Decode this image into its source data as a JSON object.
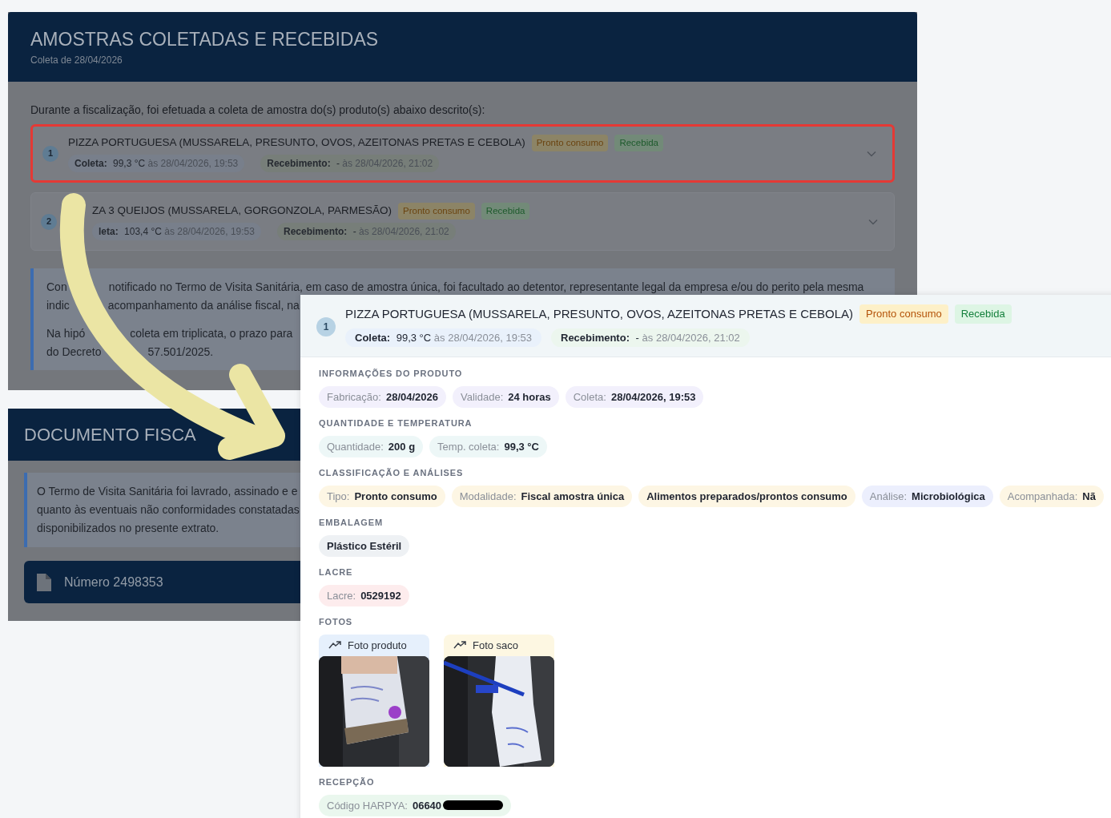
{
  "background_page": {
    "samples_section": {
      "title": "AMOSTRAS COLETADAS E RECEBIDAS",
      "subtitle": "Coleta de 28/04/2026",
      "intro": "Durante a fiscalização, foi efetuada a coleta de amostra do(s) produto(s) abaixo descrito(s):",
      "samples": [
        {
          "number": "1",
          "name": "PIZZA PORTUGUESA (MUSSARELA, PRESUNTO, OVOS, AZEITONAS PRETAS E CEBOLA)",
          "tags": [
            {
              "label": "Pronto consumo",
              "kind": "category"
            },
            {
              "label": "Recebida",
              "kind": "status"
            }
          ],
          "coleta_label": "Coleta:",
          "coleta_value": "99,3 °C",
          "coleta_time": "às 28/04/2026, 19:53",
          "recebimento_label": "Recebimento:",
          "recebimento_value": "-",
          "recebimento_time": "às 28/04/2026, 21:02",
          "highlighted": true
        },
        {
          "number": "2",
          "name": "ZA 3 QUEIJOS (MUSSARELA, GORGONZOLA, PARMESÃO)",
          "tags": [
            {
              "label": "Pronto consumo",
              "kind": "category"
            },
            {
              "label": "Recebida",
              "kind": "status"
            }
          ],
          "coleta_label": "leta:",
          "coleta_value": "103,4 °C",
          "coleta_time": "às 28/04/2026, 19:53",
          "recebimento_label": "Recebimento:",
          "recebimento_value": "-",
          "recebimento_time": "às 28/04/2026, 21:02",
          "highlighted": false
        }
      ],
      "note_lines": [
        {
          "left": "Con",
          "right": "notificado no Termo de Visita Sanitária, em caso de amostra única, foi facultado ao detentor, representante legal da empresa e/ou do perito pela mesma"
        },
        {
          "left": "indic",
          "right": "acompanhamento da análise fiscal, na"
        },
        {
          "left": "Na hipó",
          "right": "coleta em triplicata, o prazo para"
        },
        {
          "left": "do Decreto",
          "right": "57.501/2025."
        }
      ]
    },
    "document_section": {
      "title": "DOCUMENTO FISCA",
      "note_lines": [
        "O Termo de Visita Sanitária foi lavrado, assinado e e",
        "quanto às eventuais não conformidades constatadas",
        "disponibilizados no presente extrato."
      ],
      "document_button": "Número 2498353"
    }
  },
  "detail_panel": {
    "number": "1",
    "name": "PIZZA PORTUGUESA (MUSSARELA, PRESUNTO, OVOS, AZEITONAS PRETAS E CEBOLA)",
    "tags": [
      {
        "label": "Pronto consumo",
        "kind": "category"
      },
      {
        "label": "Recebida",
        "kind": "status"
      }
    ],
    "coleta_label": "Coleta:",
    "coleta_value": "99,3 °C",
    "coleta_time": "às 28/04/2026, 19:53",
    "recebimento_label": "Recebimento:",
    "recebimento_value": "-",
    "recebimento_time": "às 28/04/2026, 21:02",
    "sections": [
      {
        "heading": "INFORMAÇÕES DO PRODUTO",
        "kind": "chips",
        "chips": [
          {
            "label": "Fabricação:",
            "value": "28/04/2026",
            "kind": "info"
          },
          {
            "label": "Validade:",
            "value": "24 horas",
            "kind": "info"
          },
          {
            "label": "Coleta:",
            "value": "28/04/2026, 19:53",
            "kind": "info"
          }
        ]
      },
      {
        "heading": "QUANTIDADE E TEMPERATURA",
        "kind": "chips",
        "chips": [
          {
            "label": "Quantidade:",
            "value": "200 g",
            "kind": "quantity"
          },
          {
            "label": "Temp. coleta:",
            "value": "99,3 °C",
            "kind": "quantity"
          }
        ]
      },
      {
        "heading": "CLASSIFICAÇÃO E ANÁLISES",
        "kind": "chips",
        "chips": [
          {
            "label": "Tipo:",
            "value": "Pronto consumo",
            "kind": "class"
          },
          {
            "label": "Modalidade:",
            "value": "Fiscal amostra única",
            "kind": "class"
          },
          {
            "value": "Alimentos preparados/prontos consumo",
            "kind": "class"
          },
          {
            "label": "Análise:",
            "value": "Microbiológica",
            "kind": "analysis"
          },
          {
            "label": "Acompanhada:",
            "value": "Nã",
            "kind": "class"
          }
        ]
      },
      {
        "heading": "EMBALAGEM",
        "kind": "chips",
        "chips": [
          {
            "value": "Plástico Estéril",
            "kind": "package"
          }
        ]
      },
      {
        "heading": "LACRE",
        "kind": "chips",
        "chips": [
          {
            "label": "Lacre:",
            "value": "0529192",
            "kind": "seal"
          }
        ]
      },
      {
        "heading": "FOTOS",
        "kind": "photos",
        "photos": [
          {
            "label": "Foto produto",
            "kind": "product"
          },
          {
            "label": "Foto saco",
            "kind": "bag"
          }
        ]
      },
      {
        "heading": "RECEPÇÃO",
        "kind": "chips",
        "chips": [
          {
            "label": "Código HARPYA:",
            "value": "06640",
            "kind": "reception",
            "redacted": true
          }
        ]
      }
    ]
  }
}
